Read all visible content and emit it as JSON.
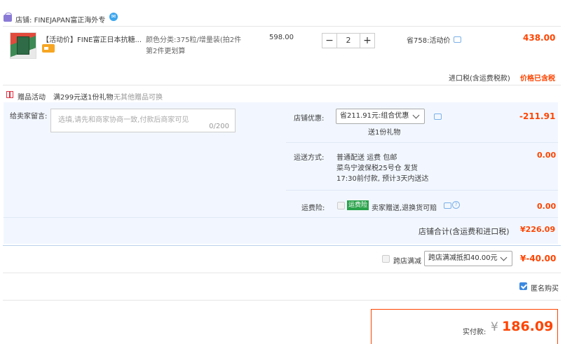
{
  "shop": {
    "label": "店铺:",
    "name": "FINEJAPAN富正海外专",
    "ww_icon": "wangwang-chat-icon"
  },
  "item": {
    "title": "【活动价】FINE富正日本抗糖...",
    "sku_line1": "颜色分类:375粒/增量装(拍2件",
    "sku_line2": "第2件更划算",
    "unit_price": "598.00",
    "quantity": "2",
    "qty_minus": "−",
    "qty_plus": "+",
    "discount": "省758:活动价",
    "subtotal": "438.00",
    "tax_label": "进口税(含运费税款)",
    "tax_value": "价格已含税"
  },
  "gift": {
    "label": "赠品活动",
    "desc": "满299元送1份礼物",
    "note": "无其他赠品可换"
  },
  "message": {
    "label": "给卖家留言:",
    "placeholder": "选填,请先和商家协商一致,付款后商家可见",
    "counter": "0/200"
  },
  "shop_discount": {
    "label": "店铺优惠:",
    "selected": "省211.91元:组合优惠",
    "sub": "送1份礼物",
    "value": "-211.91"
  },
  "shipping": {
    "label": "运送方式:",
    "line1": "普通配送 运费 包邮",
    "line2": "菜鸟宁波保税25号仓  发货",
    "line3": "17:30前付款, 预计3天内送达",
    "value": "0.00"
  },
  "insurance": {
    "label": "运费险:",
    "badge": "运费险",
    "text": "卖家赠送,退换货可赔",
    "value": "0.00"
  },
  "shop_total": {
    "label": "店铺合计(含运费和进口税)",
    "value": "¥226.09"
  },
  "cross_store": {
    "label": "跨店满减",
    "selected": "跨店满减抵扣40.00元",
    "value": "¥-40.00"
  },
  "anonymous": {
    "label": "匿名购买",
    "checked": true
  },
  "payment": {
    "label": "实付款:",
    "currency": "¥",
    "amount": "186.09"
  },
  "colors": {
    "accent": "#ff4400",
    "panel": "#f2f7ff",
    "link_blue": "#3b89e0"
  }
}
